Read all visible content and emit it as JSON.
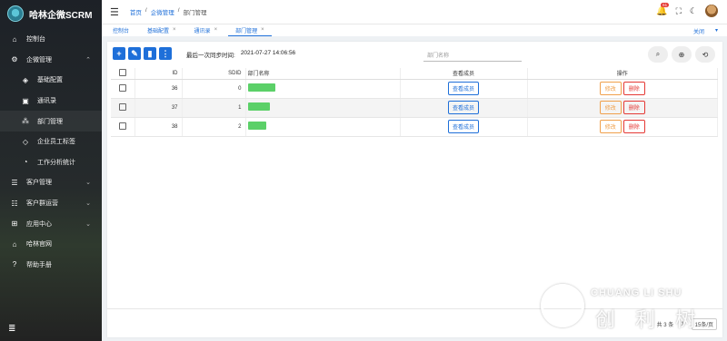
{
  "brand": {
    "title": "哈林企微SCRM"
  },
  "sidebar": {
    "items": [
      {
        "icon": "⌂",
        "label": "控制台"
      },
      {
        "icon": "⚙",
        "label": "企微管理",
        "expanded": true
      },
      {
        "icon": "◈",
        "label": "基础配置",
        "sub": true
      },
      {
        "icon": "▣",
        "label": "通讯录",
        "sub": true
      },
      {
        "icon": "⁂",
        "label": "部门管理",
        "sub": true,
        "active": true
      },
      {
        "icon": "◇",
        "label": "企业员工标签",
        "sub": true
      },
      {
        "icon": "◔",
        "label": "工作分析统计",
        "sub": true
      },
      {
        "icon": "☰",
        "label": "客户管理",
        "chev": true
      },
      {
        "icon": "☷",
        "label": "客户群运营",
        "chev": true
      },
      {
        "icon": "⊞",
        "label": "应用中心",
        "chev": true
      },
      {
        "icon": "⌂",
        "label": "哈林官网"
      },
      {
        "icon": "?",
        "label": "帮助手册"
      }
    ],
    "bottom_icon": "≣"
  },
  "header": {
    "breadcrumb": [
      "首页",
      "/",
      "企微管理",
      "/",
      "部门管理"
    ],
    "notification_count": "61"
  },
  "tabs": [
    {
      "label": "控制台",
      "closable": false
    },
    {
      "label": "基础配置",
      "closable": true
    },
    {
      "label": "通讯录",
      "closable": true
    },
    {
      "label": "部门管理",
      "closable": true,
      "active": true
    }
  ],
  "tab_close_label": "关闭",
  "toolbar": {
    "sync_label": "最后一次同步时间:",
    "sync_time": "2021-07-27 14:06:56",
    "search_placeholder": "部门名称"
  },
  "table": {
    "headers": [
      "ID",
      "SDID",
      "部门名称",
      "查看成员",
      "操作"
    ],
    "rows": [
      {
        "id": "36",
        "sdid": "0",
        "name_width": 30
      },
      {
        "id": "37",
        "sdid": "1",
        "name_width": 24
      },
      {
        "id": "38",
        "sdid": "2",
        "name_width": 20
      }
    ],
    "view_label": "查看成员",
    "edit_label": "修改",
    "delete_label": "删除"
  },
  "pager": {
    "total": "共 3 条",
    "page_size": "15条/页",
    "page": "1"
  },
  "watermark": {
    "en": "CHUANG LI SHU",
    "cn": "创 利 树"
  },
  "colors": {
    "primary": "#1e6fd9",
    "edit": "#f0a04b",
    "delete": "#e53935",
    "sidebar": "#1d2127"
  }
}
